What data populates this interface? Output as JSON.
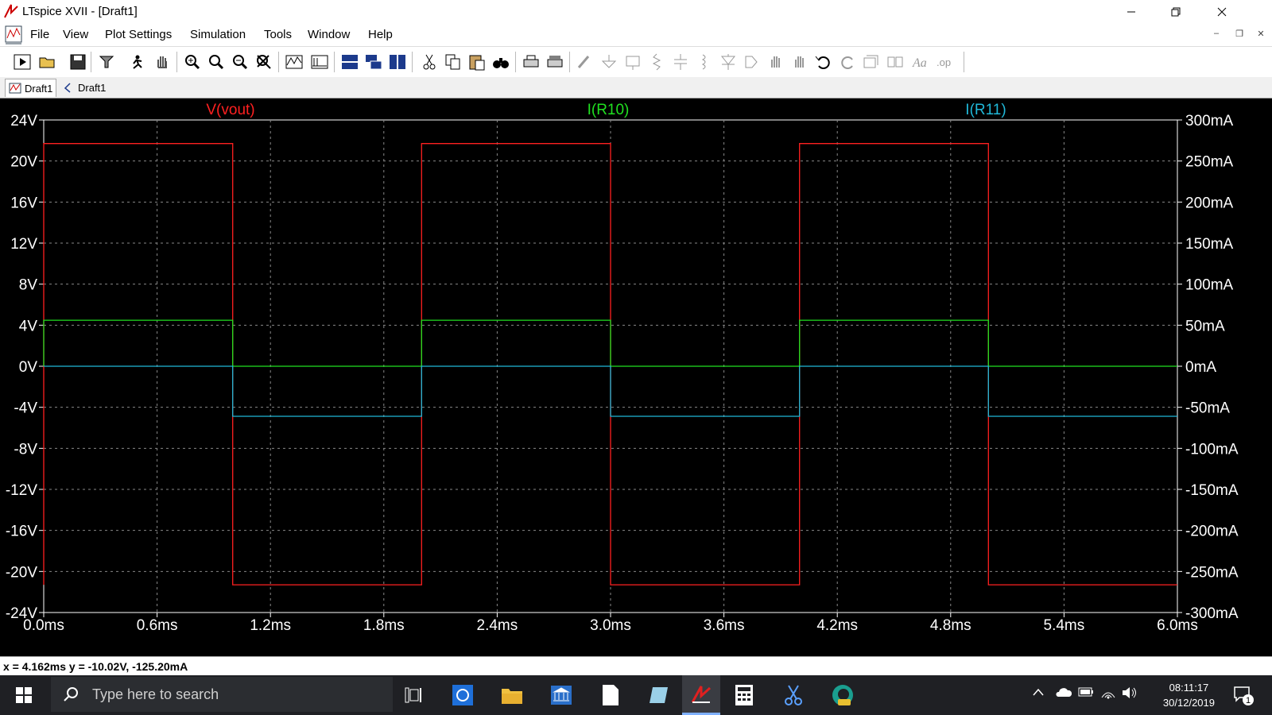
{
  "window": {
    "title": "LTspice XVII - [Draft1]"
  },
  "menu": {
    "items": [
      "File",
      "View",
      "Plot Settings",
      "Simulation",
      "Tools",
      "Window",
      "Help"
    ]
  },
  "mdi": {
    "minimize": "–",
    "restore": "❐",
    "close": "✕"
  },
  "tabs": [
    {
      "label": "Draft1",
      "icon": "waveform-icon"
    },
    {
      "label": "Draft1",
      "icon": "schematic-icon"
    }
  ],
  "status": {
    "text": "x = 4.162ms    y = -10.02V, -125.20mA"
  },
  "taskbar": {
    "search_placeholder": "Type here to search",
    "time": "08:11:17",
    "date": "30/12/2019",
    "notification_count": "1"
  },
  "chart_data": {
    "type": "line",
    "title": "",
    "x_unit": "ms",
    "x_range": [
      0,
      6.0
    ],
    "x_ticks": [
      "0.0ms",
      "0.6ms",
      "1.2ms",
      "1.8ms",
      "2.4ms",
      "3.0ms",
      "3.6ms",
      "4.2ms",
      "4.8ms",
      "5.4ms",
      "6.0ms"
    ],
    "x_tick_values": [
      0,
      0.6,
      1.2,
      1.8,
      2.4,
      3.0,
      3.6,
      4.2,
      4.8,
      5.4,
      6.0
    ],
    "y_left": {
      "unit": "V",
      "range": [
        -24,
        24
      ],
      "ticks": [
        "24V",
        "20V",
        "16V",
        "12V",
        "8V",
        "4V",
        "0V",
        "-4V",
        "-8V",
        "-12V",
        "-16V",
        "-20V",
        "-24V"
      ],
      "tick_values": [
        24,
        20,
        16,
        12,
        8,
        4,
        0,
        -4,
        -8,
        -12,
        -16,
        -20,
        -24
      ]
    },
    "y_right": {
      "unit": "mA",
      "range": [
        -300,
        300
      ],
      "ticks": [
        "300mA",
        "250mA",
        "200mA",
        "150mA",
        "100mA",
        "50mA",
        "0mA",
        "-50mA",
        "-100mA",
        "-150mA",
        "-200mA",
        "-250mA",
        "-300mA"
      ],
      "tick_values": [
        300,
        250,
        200,
        150,
        100,
        50,
        0,
        -50,
        -100,
        -150,
        -200,
        -250,
        -300
      ]
    },
    "grid": true,
    "series": [
      {
        "name": "V(vout)",
        "color": "#ff2020",
        "axis": "left",
        "x": [
          0,
          0,
          1.0,
          1.0,
          2.0,
          2.0,
          3.0,
          3.0,
          4.0,
          4.0,
          5.0,
          5.0,
          6.0
        ],
        "y": [
          -21.3,
          21.7,
          21.7,
          -21.3,
          -21.3,
          21.7,
          21.7,
          -21.3,
          -21.3,
          21.7,
          21.7,
          -21.3,
          -21.3
        ]
      },
      {
        "name": "I(R10)",
        "color": "#20e020",
        "axis": "right",
        "x": [
          0,
          0,
          1.0,
          1.0,
          2.0,
          2.0,
          3.0,
          3.0,
          4.0,
          4.0,
          5.0,
          5.0,
          6.0
        ],
        "y": [
          0,
          56,
          56,
          0,
          0,
          56,
          56,
          0,
          0,
          56,
          56,
          0,
          0
        ]
      },
      {
        "name": "I(R11)",
        "color": "#20b8d8",
        "axis": "right",
        "x": [
          0,
          1.0,
          1.0,
          2.0,
          2.0,
          3.0,
          3.0,
          4.0,
          4.0,
          5.0,
          5.0,
          6.0
        ],
        "y": [
          0,
          0,
          -61,
          -61,
          0,
          0,
          -61,
          -61,
          0,
          0,
          -61,
          -61
        ]
      }
    ]
  }
}
